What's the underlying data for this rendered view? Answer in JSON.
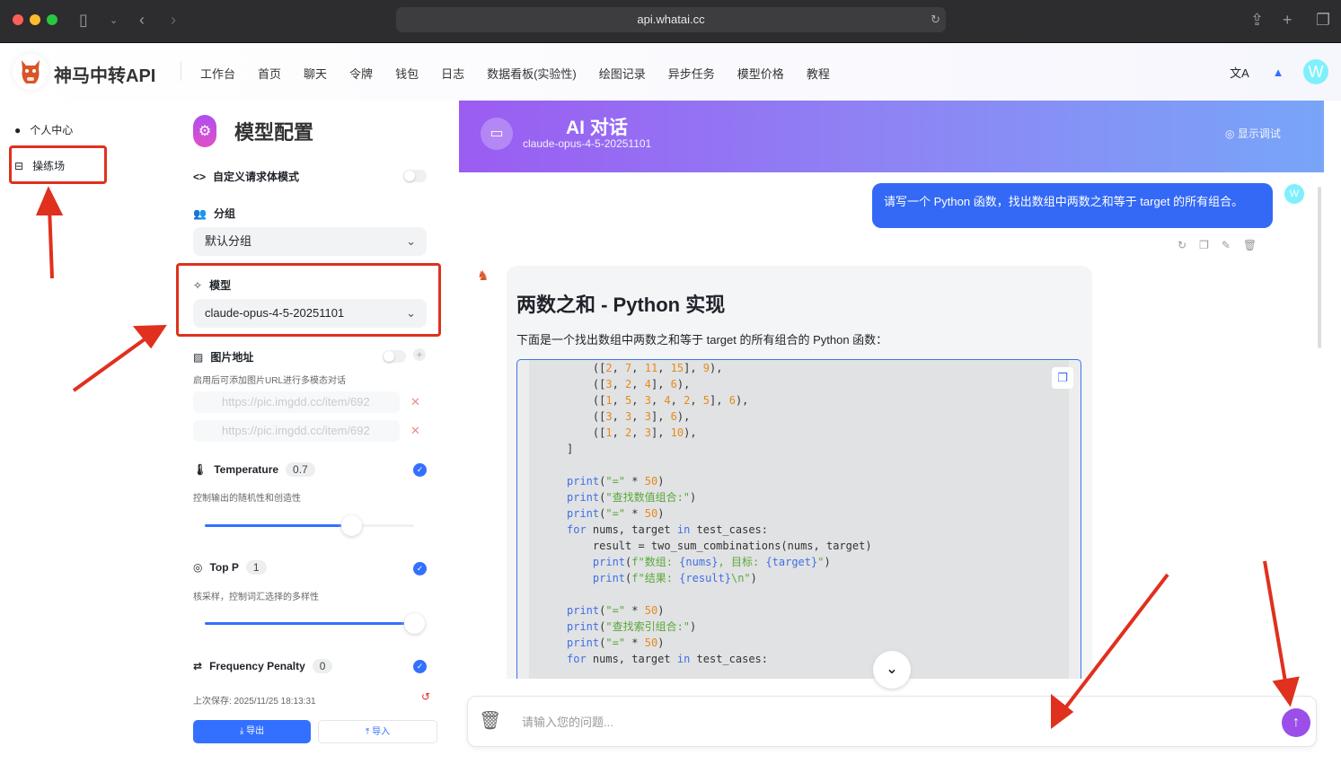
{
  "browser": {
    "url": "api.whatai.cc"
  },
  "nav": {
    "brand": "神马中转API",
    "items": [
      "工作台",
      "首页",
      "聊天",
      "令牌",
      "钱包",
      "日志",
      "数据看板(实验性)",
      "绘图记录",
      "异步任务",
      "模型价格",
      "教程"
    ],
    "avatar": "W"
  },
  "sidebar": {
    "items": [
      {
        "label": "个人中心",
        "icon": "user-icon"
      },
      {
        "label": "操练场",
        "icon": "playground-icon"
      }
    ]
  },
  "config": {
    "title": "模型配置",
    "custom_body": "自定义请求体模式",
    "group_label": "分组",
    "group_value": "默认分组",
    "model_label": "模型",
    "model_value": "claude-opus-4-5-20251101",
    "image_label": "图片地址",
    "image_desc": "启用后可添加图片URL进行多模态对话",
    "image_placeholders": [
      "https://pic.imgdd.cc/item/692",
      "https://pic.imgdd.cc/item/692"
    ],
    "temperature": {
      "label": "Temperature",
      "value": "0.7",
      "desc": "控制输出的随机性和创造性",
      "fraction": 0.7
    },
    "top_p": {
      "label": "Top P",
      "value": "1",
      "desc": "核采样，控制词汇选择的多样性",
      "fraction": 1
    },
    "freq": {
      "label": "Frequency Penalty",
      "value": "0"
    },
    "saved": "上次保存: 2025/11/25 18:13:31",
    "export": "导出",
    "import": "导入"
  },
  "chat": {
    "title": "AI 对话",
    "model": "claude-opus-4-5-20251101",
    "debug": "显示调试",
    "user_avatar": "W",
    "user_message": "请写一个 Python 函数，找出数组中两数之和等于 target 的所有组合。",
    "answer_title": "两数之和 - Python 实现",
    "answer_intro": "下面是一个找出数组中两数之和等于 target 的所有组合的 Python 函数：",
    "code": [
      [
        [
          "    ([",
          "p"
        ],
        [
          "2",
          "num"
        ],
        [
          ", ",
          "p"
        ],
        [
          "7",
          "num"
        ],
        [
          ", ",
          "p"
        ],
        [
          "11",
          "num"
        ],
        [
          ", ",
          "p"
        ],
        [
          "15",
          "num"
        ],
        [
          "], ",
          "p"
        ],
        [
          "9",
          "num"
        ],
        [
          "),",
          "p"
        ]
      ],
      [
        [
          "    ([",
          "p"
        ],
        [
          "3",
          "num"
        ],
        [
          ", ",
          "p"
        ],
        [
          "2",
          "num"
        ],
        [
          ", ",
          "p"
        ],
        [
          "4",
          "num"
        ],
        [
          "], ",
          "p"
        ],
        [
          "6",
          "num"
        ],
        [
          "),",
          "p"
        ]
      ],
      [
        [
          "    ([",
          "p"
        ],
        [
          "1",
          "num"
        ],
        [
          ", ",
          "p"
        ],
        [
          "5",
          "num"
        ],
        [
          ", ",
          "p"
        ],
        [
          "3",
          "num"
        ],
        [
          ", ",
          "p"
        ],
        [
          "4",
          "num"
        ],
        [
          ", ",
          "p"
        ],
        [
          "2",
          "num"
        ],
        [
          ", ",
          "p"
        ],
        [
          "5",
          "num"
        ],
        [
          "], ",
          "p"
        ],
        [
          "6",
          "num"
        ],
        [
          "),",
          "p"
        ]
      ],
      [
        [
          "    ([",
          "p"
        ],
        [
          "3",
          "num"
        ],
        [
          ", ",
          "p"
        ],
        [
          "3",
          "num"
        ],
        [
          ", ",
          "p"
        ],
        [
          "3",
          "num"
        ],
        [
          "], ",
          "p"
        ],
        [
          "6",
          "num"
        ],
        [
          "),",
          "p"
        ]
      ],
      [
        [
          "    ([",
          "p"
        ],
        [
          "1",
          "num"
        ],
        [
          ", ",
          "p"
        ],
        [
          "2",
          "num"
        ],
        [
          ", ",
          "p"
        ],
        [
          "3",
          "num"
        ],
        [
          "], ",
          "p"
        ],
        [
          "10",
          "num"
        ],
        [
          "),",
          "p"
        ]
      ],
      [
        [
          "]",
          "p"
        ]
      ],
      [
        [
          "",
          "p"
        ]
      ],
      [
        [
          "print",
          "kw"
        ],
        [
          "(",
          "p"
        ],
        [
          "\"=\"",
          "str"
        ],
        [
          " * ",
          "p"
        ],
        [
          "50",
          "num"
        ],
        [
          ")",
          "p"
        ]
      ],
      [
        [
          "print",
          "kw"
        ],
        [
          "(",
          "p"
        ],
        [
          "\"查找数值组合:\"",
          "str"
        ],
        [
          ")",
          "p"
        ]
      ],
      [
        [
          "print",
          "kw"
        ],
        [
          "(",
          "p"
        ],
        [
          "\"=\"",
          "str"
        ],
        [
          " * ",
          "p"
        ],
        [
          "50",
          "num"
        ],
        [
          ")",
          "p"
        ]
      ],
      [
        [
          "for",
          "kw"
        ],
        [
          " nums, target ",
          "p"
        ],
        [
          "in",
          "kw"
        ],
        [
          " test_cases:",
          "p"
        ]
      ],
      [
        [
          "    result = two_sum_combinations(nums, target)",
          "p"
        ]
      ],
      [
        [
          "    ",
          "p"
        ],
        [
          "print",
          "kw"
        ],
        [
          "(",
          "p"
        ],
        [
          "f\"数组: ",
          "str"
        ],
        [
          "{nums}",
          "kw"
        ],
        [
          ", 目标: ",
          "str"
        ],
        [
          "{target}",
          "kw"
        ],
        [
          "\"",
          "str"
        ],
        [
          ")",
          "p"
        ]
      ],
      [
        [
          "    ",
          "p"
        ],
        [
          "print",
          "kw"
        ],
        [
          "(",
          "p"
        ],
        [
          "f\"结果: ",
          "str"
        ],
        [
          "{result}",
          "kw"
        ],
        [
          "\\n\"",
          "str"
        ],
        [
          ")",
          "p"
        ]
      ],
      [
        [
          "",
          "p"
        ]
      ],
      [
        [
          "print",
          "kw"
        ],
        [
          "(",
          "p"
        ],
        [
          "\"=\"",
          "str"
        ],
        [
          " * ",
          "p"
        ],
        [
          "50",
          "num"
        ],
        [
          ")",
          "p"
        ]
      ],
      [
        [
          "print",
          "kw"
        ],
        [
          "(",
          "p"
        ],
        [
          "\"查找索引组合:\"",
          "str"
        ],
        [
          ")",
          "p"
        ]
      ],
      [
        [
          "print",
          "kw"
        ],
        [
          "(",
          "p"
        ],
        [
          "\"=\"",
          "str"
        ],
        [
          " * ",
          "p"
        ],
        [
          "50",
          "num"
        ],
        [
          ")",
          "p"
        ]
      ],
      [
        [
          "for",
          "kw"
        ],
        [
          " nums, target ",
          "p"
        ],
        [
          "in",
          "kw"
        ],
        [
          " test_cases:",
          "p"
        ]
      ]
    ],
    "input_placeholder": "请输入您的问题..."
  },
  "colors": {
    "accent": "#3370ff",
    "annotation": "#e0301e",
    "header_start": "#9b5cf2",
    "header_end": "#78a5f8"
  }
}
